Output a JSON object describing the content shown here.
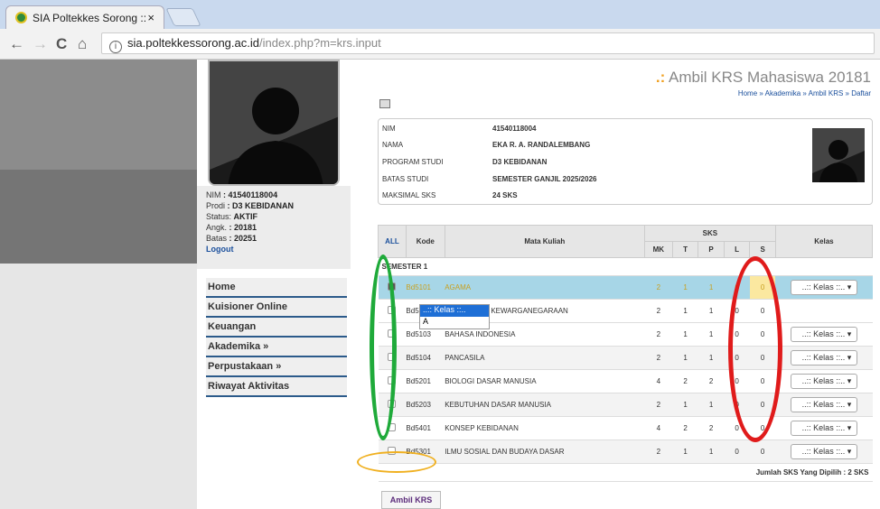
{
  "browser": {
    "tab_title": "SIA Poltekkes Sorong ::",
    "tab_close": "×",
    "url_host": "sia.poltekkessorong.ac.id",
    "url_path": "/index.php?m=krs.input",
    "info_icon": "i",
    "back": "←",
    "forward": "→",
    "reload": "C",
    "home": "⌂"
  },
  "sidebar": {
    "nim_label": "NIM",
    "nim": ": 41540118004",
    "prodi_label": "Prodi",
    "prodi": ": D3 KEBIDANAN",
    "status_label": "Status:",
    "status": "AKTIF",
    "angk_label": "Angk.",
    "angk": ": 20181",
    "batas_label": "Batas",
    "batas": ": 20251",
    "logout": "Logout",
    "menu": [
      "Home",
      "Kuisioner Online",
      "Keuangan",
      "Akademika »",
      "Perpustakaan »",
      "Riwayat Aktivitas"
    ]
  },
  "header": {
    "title": "Ambil KRS Mahasiswa 20181",
    "dots": ".:",
    "breadcrumb": "Home » Akademika » Ambil KRS » Daftar"
  },
  "info": {
    "rows": [
      {
        "k": "NIM",
        "v": "41540118004"
      },
      {
        "k": "NAMA",
        "v": "EKA R. A. RANDALEMBANG"
      },
      {
        "k": "PROGRAM STUDI",
        "v": "D3 KEBIDANAN"
      },
      {
        "k": "BATAS STUDI",
        "v": "SEMESTER GANJIL 2025/2026"
      },
      {
        "k": "MAKSIMAL SKS",
        "v": "24 SKS"
      }
    ]
  },
  "table": {
    "h_all": "ALL",
    "h_kode": "Kode",
    "h_mk": "Mata Kuliah",
    "h_sks": "SKS",
    "h_kelas": "Kelas",
    "sub": [
      "MK",
      "T",
      "P",
      "L",
      "S"
    ],
    "semester": "SEMESTER 1",
    "rows": [
      {
        "kode": "Bd5101",
        "mk": "AGAMA",
        "v": [
          "2",
          "1",
          "1",
          "0",
          "0"
        ],
        "kelas": "..:: Kelas ::..",
        "checked": true
      },
      {
        "kode": "Bd5102",
        "mk": "PENDIDIKAN KEWARGANEGARAAN",
        "v": [
          "2",
          "1",
          "1",
          "0",
          "0"
        ],
        "kelas": "..:: Kelas ::..",
        "checked": false
      },
      {
        "kode": "Bd5103",
        "mk": "BAHASA INDONESIA",
        "v": [
          "2",
          "1",
          "1",
          "0",
          "0"
        ],
        "kelas": "..:: Kelas ::..",
        "checked": false
      },
      {
        "kode": "Bd5104",
        "mk": "PANCASILA",
        "v": [
          "2",
          "1",
          "1",
          "0",
          "0"
        ],
        "kelas": "..:: Kelas ::..",
        "checked": false
      },
      {
        "kode": "Bd5201",
        "mk": "BIOLOGI DASAR MANUSIA",
        "v": [
          "4",
          "2",
          "2",
          "0",
          "0"
        ],
        "kelas": "..:: Kelas ::..",
        "checked": false
      },
      {
        "kode": "Bd5203",
        "mk": "KEBUTUHAN DASAR MANUSIA",
        "v": [
          "2",
          "1",
          "1",
          "0",
          "0"
        ],
        "kelas": "..:: Kelas ::..",
        "checked": false
      },
      {
        "kode": "Bd5401",
        "mk": "KONSEP KEBIDANAN",
        "v": [
          "4",
          "2",
          "2",
          "0",
          "0"
        ],
        "kelas": "..:: Kelas ::..",
        "checked": false
      },
      {
        "kode": "Bd5301",
        "mk": "ILMU SOSIAL DAN BUDAYA DASAR",
        "v": [
          "2",
          "1",
          "1",
          "0",
          "0"
        ],
        "kelas": "..:: Kelas ::..",
        "checked": false
      }
    ],
    "dropdown_options": [
      "..:: Kelas ::..",
      "A"
    ],
    "total": "Jumlah SKS Yang Dipilih : 2 SKS"
  },
  "ambil_button": "Ambil KRS",
  "colors": {
    "link": "#1a4f9c",
    "accent": "#f0a020",
    "selected_row": "#a7d6e7",
    "annot_green": "#1faa3a",
    "annot_red": "#e01b1b",
    "annot_yellow": "#f0b020"
  }
}
